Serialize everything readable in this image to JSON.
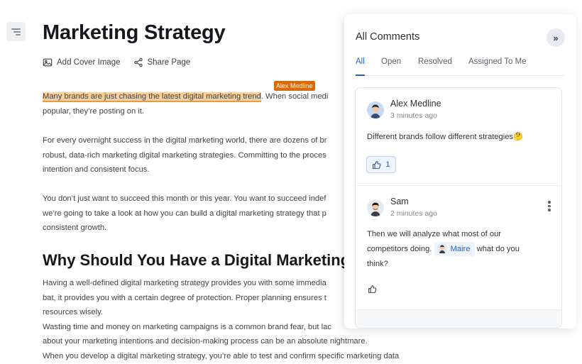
{
  "document": {
    "title": "Marketing Strategy",
    "actions": {
      "add_cover": "Add Cover Image",
      "share": "Share Page"
    },
    "highlight_author": "Alex Medline",
    "p1": {
      "highlight": "Many brands are just chasing the latest digital marketing trend",
      "rest": ". When social medi",
      "line2": "popular, they’re posting on it."
    },
    "p2": [
      "For every overnight success in the digital marketing world, there are dozens of br",
      "robust, data-rich marketing digital marketing strategies. Committing to the proces",
      "intention and consistent focus."
    ],
    "p3": [
      "You don’t just want to succeed this month or this year. You want to succeed indef",
      "we’re going to take a look at how you can build a digital marketing strategy that p",
      "consistent growth."
    ],
    "heading2": "Why Should You Have a Digital Marketing",
    "p4": [
      "Having a well-defined digital marketing strategy provides you with some immedia",
      "bat, it provides you with a certain degree of protection. Proper planning ensures t",
      "resources wisely.",
      "Wasting time and money on marketing campaigns is a common brand fear, but lac",
      "about your marketing intentions and decision-making process can be an absolute nightmare.",
      "When you develop a digital marketing strategy, you’re able to test and confirm specific marketing data"
    ]
  },
  "comments_panel": {
    "title": "All Comments",
    "collapse_label": "»",
    "tabs": [
      {
        "label": "All",
        "active": true
      },
      {
        "label": "Open",
        "active": false
      },
      {
        "label": "Resolved",
        "active": false
      },
      {
        "label": "Assigned To Me",
        "active": false
      }
    ],
    "comments": [
      {
        "author": "Alex Medline",
        "time": "3 minutes ago",
        "text": "Different brands follow different strategies🤔",
        "likes": "1"
      },
      {
        "author": "Sam",
        "time": "2 minutes ago",
        "line1": "Then we will analyze what most of our",
        "line2_pre": "competitors doing.",
        "mention": "Maire",
        "line2_post": "what do you",
        "line3": "think?"
      }
    ]
  },
  "colors": {
    "accent": "#2563c9",
    "highlight": "#f7cf9b",
    "author_tag": "#d86b0e"
  }
}
